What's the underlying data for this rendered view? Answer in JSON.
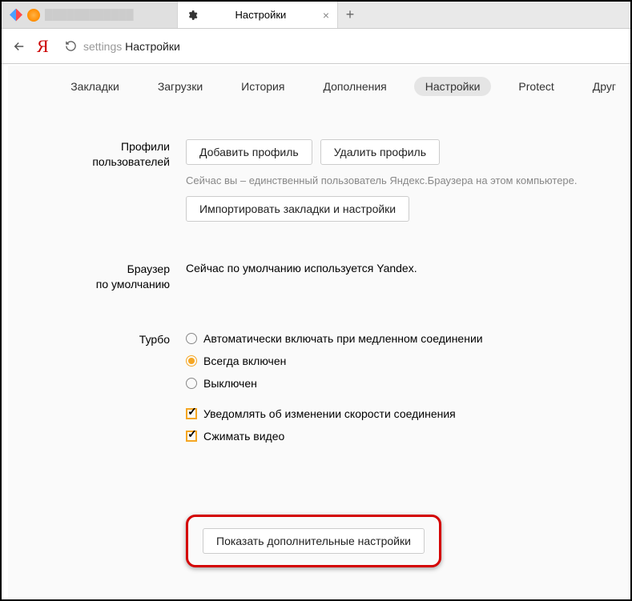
{
  "tabs": {
    "bg_title": "████████████",
    "active_title": "Настройки"
  },
  "urlbar": {
    "ya": "Я",
    "path_muted": "settings ",
    "path": "Настройки"
  },
  "nav": {
    "items": [
      {
        "label": "Закладки"
      },
      {
        "label": "Загрузки"
      },
      {
        "label": "История"
      },
      {
        "label": "Дополнения"
      },
      {
        "label": "Настройки"
      },
      {
        "label": "Protect"
      },
      {
        "label": "Друг"
      }
    ]
  },
  "profiles": {
    "label_line1": "Профили",
    "label_line2": "пользователей",
    "add": "Добавить профиль",
    "remove": "Удалить профиль",
    "hint": "Сейчас вы – единственный пользователь Яндекс.Браузера на этом компьютере.",
    "import": "Импортировать закладки и настройки"
  },
  "default": {
    "label_line1": "Браузер",
    "label_line2": "по умолчанию",
    "text": "Сейчас по умолчанию используется Yandex."
  },
  "turbo": {
    "label": "Турбо",
    "r_auto": "Автоматически включать при медленном соединении",
    "r_on": "Всегда включен",
    "r_off": "Выключен",
    "c_notify": "Уведомлять об изменении скорости соединения",
    "c_video": "Сжимать видео"
  },
  "advanced_btn": "Показать дополнительные настройки"
}
